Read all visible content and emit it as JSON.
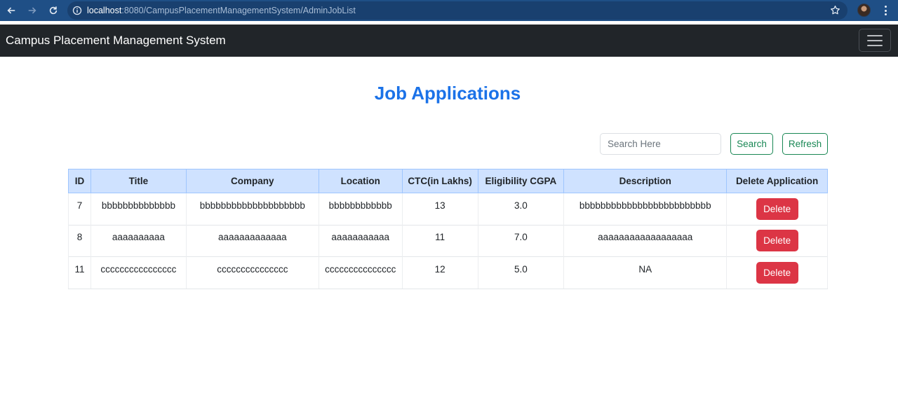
{
  "browser": {
    "url_host": "localhost",
    "url_rest": ":8080/CampusPlacementManagementSystem/AdminJobList",
    "icons": [
      "back-arrow-icon",
      "forward-arrow-icon",
      "reload-icon",
      "info-icon",
      "star-icon",
      "avatar",
      "more-vert-icon"
    ]
  },
  "navbar": {
    "brand": "Campus Placement Management System",
    "toggler_icon": "hamburger-icon"
  },
  "page": {
    "title": "Job Applications"
  },
  "search": {
    "placeholder": "Search Here",
    "value": "",
    "search_label": "Search",
    "refresh_label": "Refresh"
  },
  "table": {
    "headers": [
      "ID",
      "Title",
      "Company",
      "Location",
      "CTC(in Lakhs)",
      "Eligibility CGPA",
      "Description",
      "Delete Application"
    ],
    "rows": [
      [
        "7",
        "bbbbbbbbbbbbbb",
        "bbbbbbbbbbbbbbbbbbbb",
        "bbbbbbbbbbbb",
        "13",
        "3.0",
        "bbbbbbbbbbbbbbbbbbbbbbbbb",
        "Delete"
      ],
      [
        "8",
        "aaaaaaaaaa",
        "aaaaaaaaaaaaa",
        "aaaaaaaaaaa",
        "11",
        "7.0",
        "aaaaaaaaaaaaaaaaaa",
        "Delete"
      ],
      [
        "11",
        "cccccccccccccccc",
        "ccccccccccccccc",
        "ccccccccccccccc",
        "12",
        "5.0",
        "NA",
        "Delete"
      ]
    ]
  },
  "colors": {
    "browser_bar": "#1f4f86",
    "navbar": "#212529",
    "title": "#1b72e8",
    "outline_success": "#198754",
    "danger": "#dc3545",
    "table_header": "#cfe2ff"
  }
}
